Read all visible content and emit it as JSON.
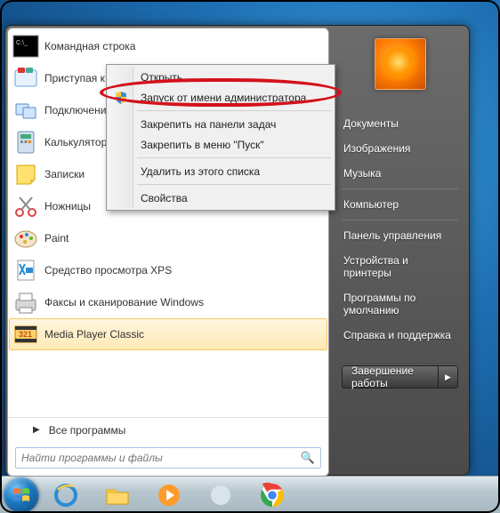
{
  "programs": [
    {
      "label": "Командная строка"
    },
    {
      "label": "Приступая к работе"
    },
    {
      "label": "Подключение"
    },
    {
      "label": "Калькулятор"
    },
    {
      "label": "Записки"
    },
    {
      "label": "Ножницы"
    },
    {
      "label": "Paint"
    },
    {
      "label": "Средство просмотра XPS"
    },
    {
      "label": "Факсы и сканирование Windows"
    },
    {
      "label": "Media Player Classic"
    }
  ],
  "all_programs": "Все программы",
  "search_placeholder": "Найти программы и файлы",
  "right": {
    "items_top": [
      "Документы",
      "Изображения",
      "Музыка"
    ],
    "items_mid": [
      "Компьютер"
    ],
    "items_bot": [
      "Панель управления",
      "Устройства и принтеры",
      "Программы по умолчанию",
      "Справка и поддержка"
    ]
  },
  "shutdown": {
    "label": "Завершение работы"
  },
  "context_menu": {
    "items": [
      {
        "label": "Открыть"
      },
      {
        "label": "Запуск от имени администратора",
        "shield": true
      },
      {
        "sep": true
      },
      {
        "label": "Закрепить на панели задач"
      },
      {
        "label": "Закрепить в меню \"Пуск\""
      },
      {
        "sep": true
      },
      {
        "label": "Удалить из этого списка"
      },
      {
        "sep": true
      },
      {
        "label": "Свойства"
      }
    ]
  }
}
